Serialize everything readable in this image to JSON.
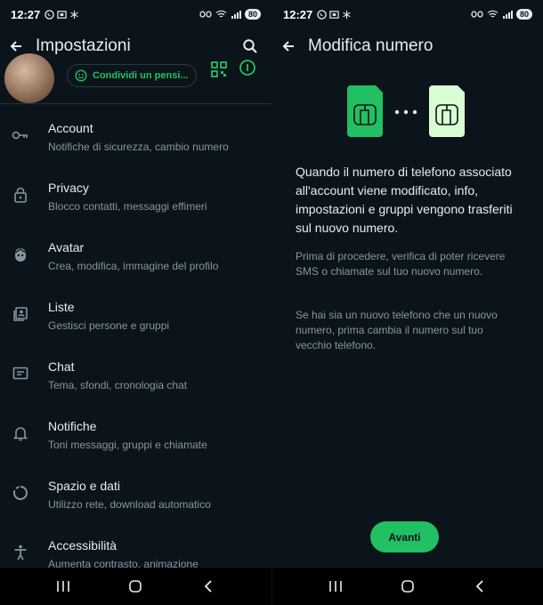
{
  "left": {
    "status": {
      "time": "12:27",
      "battery": "80"
    },
    "title": "Impostazioni",
    "profile": {
      "status_pill": "Condividi un pensi..."
    },
    "items": [
      {
        "title": "Account",
        "subtitle": "Notifiche di sicurezza, cambio numero",
        "icon": "key-icon"
      },
      {
        "title": "Privacy",
        "subtitle": "Blocco contatti, messaggi effimeri",
        "icon": "lock-icon"
      },
      {
        "title": "Avatar",
        "subtitle": "Crea, modifica, immagine del profilo",
        "icon": "avatar-face-icon"
      },
      {
        "title": "Liste",
        "subtitle": "Gestisci persone e gruppi",
        "icon": "contacts-list-icon"
      },
      {
        "title": "Chat",
        "subtitle": "Tema, sfondi, cronologia chat",
        "icon": "chat-icon"
      },
      {
        "title": "Notifiche",
        "subtitle": "Toni messaggi, gruppi e chiamate",
        "icon": "bell-icon"
      },
      {
        "title": "Spazio e dati",
        "subtitle": "Utilizzo rete, download automatico",
        "icon": "storage-circle-icon"
      },
      {
        "title": "Accessibilità",
        "subtitle": "Aumenta contrasto, animazione",
        "icon": "accessibility-icon"
      }
    ]
  },
  "right": {
    "status": {
      "time": "12:27",
      "battery": "80"
    },
    "title": "Modifica numero",
    "headline": "Quando il numero di telefono associato all'account viene modificato, info, impostazioni e gruppi vengono trasferiti sul nuovo numero.",
    "para1": "Prima di procedere, verifica di poter ricevere SMS o chiamate sul tuo nuovo numero.",
    "para2": "Se hai sia un nuovo telefono che un nuovo numero, prima cambia il numero sul tuo vecchio telefono.",
    "button": "Avanti"
  },
  "colors": {
    "bg": "#0b141a",
    "accent": "#21c063",
    "text": "#e9edef",
    "muted": "#8696a0",
    "sim_light": "#d9fdd3"
  }
}
